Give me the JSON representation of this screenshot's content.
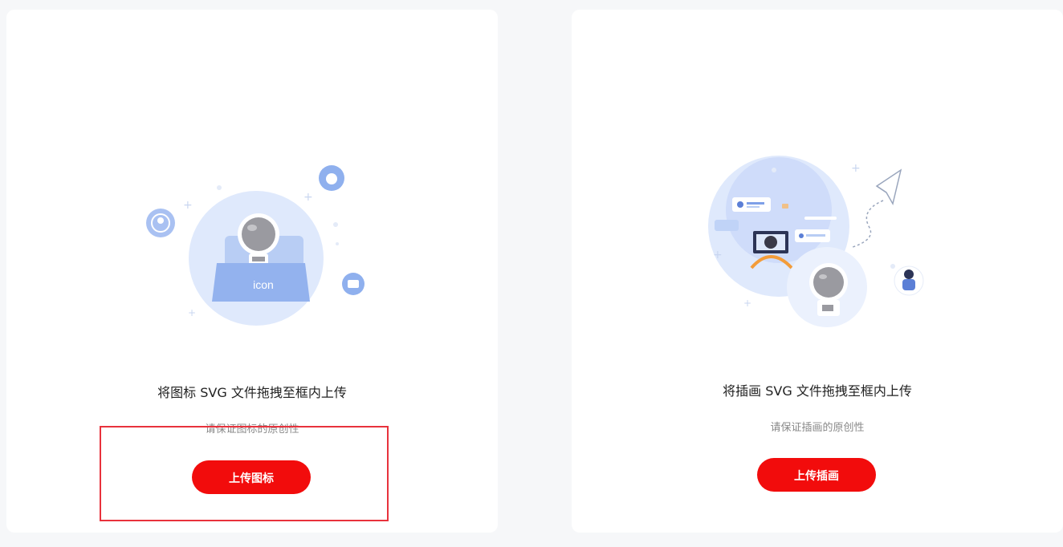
{
  "upload_icon_card": {
    "illustration_label": "icon",
    "title": "将图标 SVG 文件拖拽至框内上传",
    "subtitle": "请保证图标的原创性",
    "button_label": "上传图标"
  },
  "upload_illustration_card": {
    "title": "将插画 SVG 文件拖拽至框内上传",
    "subtitle": "请保证插画的原创性",
    "button_label": "上传插画"
  },
  "colors": {
    "accent_red": "#f20c0c",
    "illustration_blue": "#d9e5fb",
    "highlight_border": "#e8323c"
  }
}
